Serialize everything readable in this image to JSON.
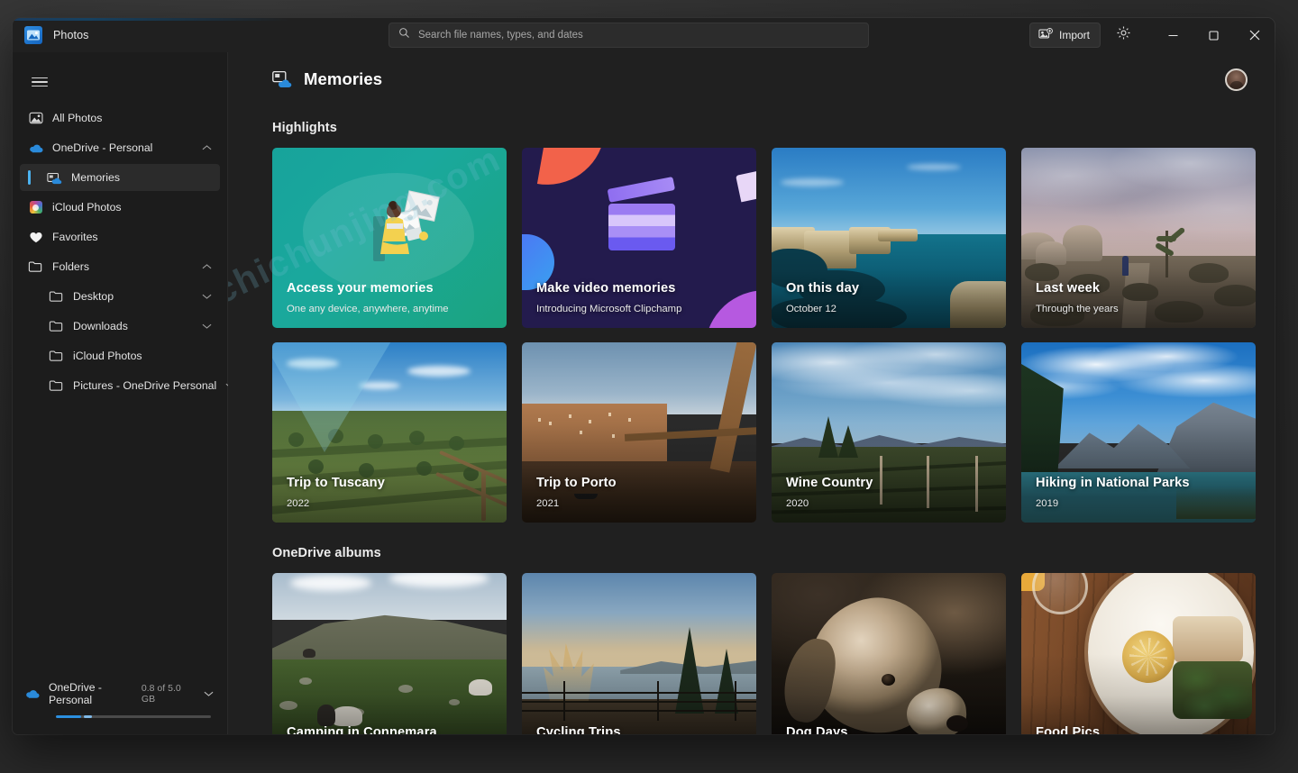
{
  "titlebar": {
    "app_name": "Photos",
    "app_icon": "photos-app-icon",
    "search_placeholder": "Search file names, types, and dates",
    "search_value": "",
    "search_icon": "search-icon",
    "import_label": "Import",
    "import_icon": "import-photo-icon",
    "settings_icon": "gear-icon",
    "minimize_icon": "minimize-icon",
    "maximize_icon": "maximize-icon",
    "close_icon": "close-icon"
  },
  "sidebar": {
    "menu_icon": "hamburger-menu-icon",
    "items": [
      {
        "label": "All Photos",
        "icon": "all-photos-icon",
        "level": 0,
        "selected": false,
        "chevron": ""
      },
      {
        "label": "OneDrive - Personal",
        "icon": "onedrive-cloud-icon",
        "level": 0,
        "selected": false,
        "chevron": "up"
      },
      {
        "label": "Memories",
        "icon": "memories-icon",
        "level": 1,
        "selected": true,
        "chevron": ""
      },
      {
        "label": "iCloud Photos",
        "icon": "icloud-photos-icon",
        "level": 0,
        "selected": false,
        "chevron": ""
      },
      {
        "label": "Favorites",
        "icon": "heart-icon",
        "level": 0,
        "selected": false,
        "chevron": ""
      },
      {
        "label": "Folders",
        "icon": "folder-icon",
        "level": 0,
        "selected": false,
        "chevron": "up"
      },
      {
        "label": "Desktop",
        "icon": "folder-icon",
        "level": 1,
        "selected": false,
        "chevron": "down"
      },
      {
        "label": "Downloads",
        "icon": "folder-icon",
        "level": 1,
        "selected": false,
        "chevron": "down"
      },
      {
        "label": "iCloud Photos",
        "icon": "folder-icon",
        "level": 1,
        "selected": false,
        "chevron": ""
      },
      {
        "label": "Pictures - OneDrive Personal",
        "icon": "folder-icon",
        "level": 1,
        "selected": false,
        "chevron": "down"
      }
    ],
    "storage": {
      "account": "OneDrive - Personal",
      "usage": "0.8 of 5.0 GB",
      "icon": "onedrive-cloud-icon",
      "chevron": "down",
      "percent": 16
    }
  },
  "main": {
    "page_title": "Memories",
    "page_icon": "memories-icon",
    "avatar": "user-avatar",
    "sections": [
      {
        "title": "Highlights",
        "cards": [
          {
            "title": "Access your memories",
            "subtitle": "One any device, anywhere, anytime",
            "kind": "promo-teal"
          },
          {
            "title": "Make video memories",
            "subtitle": "Introducing Microsoft Clipchamp",
            "kind": "promo-navy"
          },
          {
            "title": "On this day",
            "subtitle": "October 12",
            "kind": "photo-sea"
          },
          {
            "title": "Last week",
            "subtitle": "Through the years",
            "kind": "photo-desert"
          },
          {
            "title": "Trip to Tuscany",
            "subtitle": "2022",
            "kind": "photo-tuscany"
          },
          {
            "title": "Trip to Porto",
            "subtitle": "2021",
            "kind": "photo-porto"
          },
          {
            "title": "Wine Country",
            "subtitle": "2020",
            "kind": "photo-wine"
          },
          {
            "title": "Hiking in National Parks",
            "subtitle": "2019",
            "kind": "photo-park"
          }
        ]
      },
      {
        "title": "OneDrive albums",
        "cards": [
          {
            "title": "Camping in Connemara",
            "subtitle": "",
            "kind": "photo-connemara"
          },
          {
            "title": "Cycling Trips",
            "subtitle": "",
            "kind": "photo-cycling"
          },
          {
            "title": "Dog Days",
            "subtitle": "",
            "kind": "photo-dog"
          },
          {
            "title": "Food Pics",
            "subtitle": "",
            "kind": "photo-food"
          }
        ]
      }
    ]
  },
  "colors": {
    "accent": "#4cb3f0",
    "window_bg": "#202020",
    "sidebar_bg": "#1c1c1c",
    "teal_card": "#17a39b",
    "navy_card": "#231b4d",
    "progress": "#2b8fe0"
  },
  "watermark": "chichunjing.com"
}
